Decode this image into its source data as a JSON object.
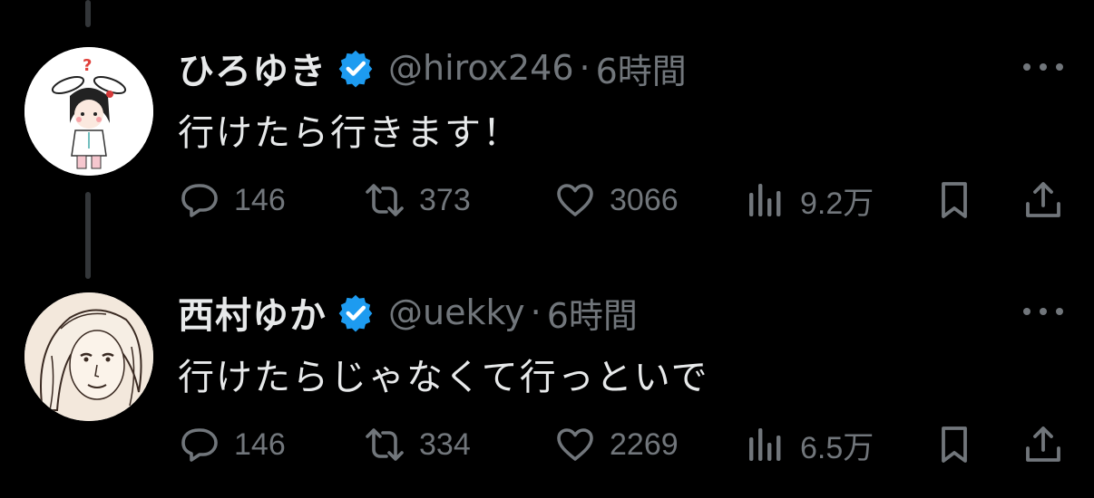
{
  "colors": {
    "background": "#000000",
    "primary_text": "#e7e9ea",
    "secondary_text": "#71767b",
    "verified_badge": "#1d9bf0",
    "thread_line": "#333639"
  },
  "tweets": [
    {
      "display_name": "ひろゆき",
      "verified": true,
      "handle": "@hirox246",
      "separator": "·",
      "time": "6時間",
      "text": "行けたら行きます！",
      "actions": {
        "replies": "146",
        "retweets": "373",
        "likes": "3066",
        "views": "9.2万"
      }
    },
    {
      "display_name": "西村ゆか",
      "verified": true,
      "handle": "@uekky",
      "separator": "·",
      "time": "6時間",
      "text": "行けたらじゃなくて行っといで",
      "actions": {
        "replies": "146",
        "retweets": "334",
        "likes": "2269",
        "views": "6.5万"
      }
    }
  ],
  "icons": {
    "reply": "reply-icon",
    "retweet": "retweet-icon",
    "like": "heart-icon",
    "views": "views-bar-chart-icon",
    "bookmark": "bookmark-icon",
    "share": "share-icon",
    "more": "more-dots-icon",
    "verified": "verified-badge-icon"
  }
}
